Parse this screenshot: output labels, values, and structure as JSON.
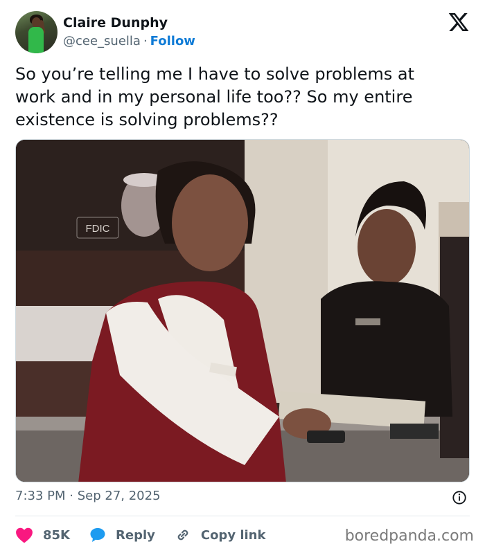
{
  "author": {
    "name": "Claire Dunphy",
    "handle": "@cee_suella",
    "separator": "·",
    "follow_label": "Follow"
  },
  "tweet": {
    "text": "So you’re telling me I have to solve problems at work and in my personal life too?? So my entire existence is solving problems??",
    "time": "7:33 PM",
    "date_separator": "·",
    "date": "Sep 27, 2025"
  },
  "media": {
    "sign_text": "FDIC"
  },
  "actions": {
    "likes": "85K",
    "reply_label": "Reply",
    "copy_label": "Copy link"
  },
  "watermark": "boredpanda.com",
  "colors": {
    "follow": "#0f7bd6",
    "like": "#f91880",
    "reply": "#1d9bf0",
    "secondary_text": "#536471"
  },
  "icons": {
    "logo": "x-logo-icon",
    "info": "info-icon",
    "like": "heart-icon",
    "reply": "speech-bubble-icon",
    "copy": "link-icon"
  }
}
